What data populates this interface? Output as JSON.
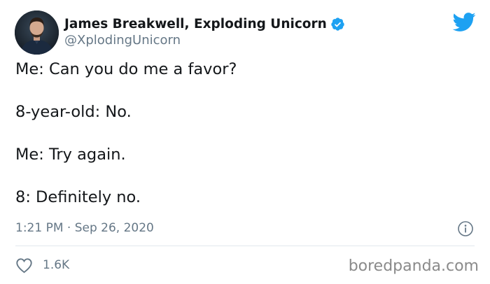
{
  "tweet": {
    "author": {
      "display_name": "James Breakwell, Exploding Unicorn",
      "handle": "@XplodingUnicorn",
      "verified": true
    },
    "lines": [
      "Me: Can you do me a favor?",
      "8-year-old: No.",
      "Me: Try again.",
      "8: Definitely no."
    ],
    "timestamp": "1:21 PM · Sep 26, 2020",
    "likes": "1.6K"
  },
  "watermark": "boredpanda.com",
  "icons": {
    "brand": "twitter-bird-icon",
    "verified": "verified-badge-icon",
    "info": "info-icon",
    "like": "heart-icon"
  },
  "colors": {
    "twitter_blue": "#1da1f2",
    "text_primary": "#14171a",
    "text_secondary": "#657786",
    "divider": "#e1e8ed",
    "watermark": "#8a8a8a"
  }
}
